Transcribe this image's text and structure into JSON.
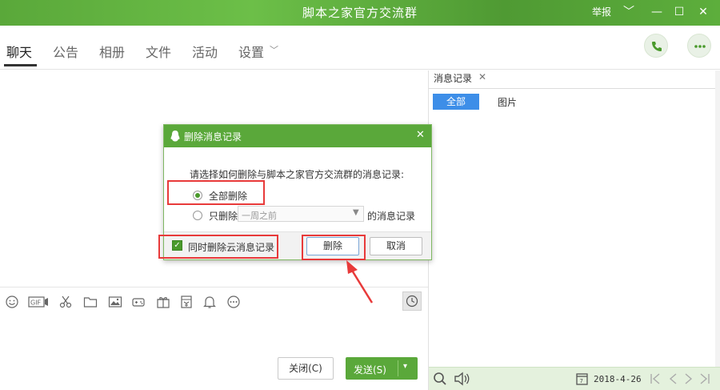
{
  "window": {
    "title": "脚本之家官方交流群",
    "report_label": "举报",
    "controls": [
      "﹀",
      "—",
      "☐",
      "✕"
    ]
  },
  "tabs": [
    {
      "label": "聊天",
      "active": true
    },
    {
      "label": "公告"
    },
    {
      "label": "相册"
    },
    {
      "label": "文件"
    },
    {
      "label": "活动"
    },
    {
      "label": "设置"
    }
  ],
  "tab_settings_chevron": "﹀",
  "composer": {
    "close_label": "关闭(C)",
    "send_label": "发送(S)",
    "send_chevron": "▾"
  },
  "history_panel": {
    "tab_label": "消息记录",
    "tab_close": "✕",
    "filter_all": "全部",
    "filter_images": "图片",
    "date": "2018-4-26"
  },
  "dialog": {
    "title": "删除消息记录",
    "close": "✕",
    "question": "请选择如何删除与脚本之家官方交流群的消息记录:",
    "option_all": "全部删除",
    "option_partial_prefix": "只删除",
    "option_partial_select": "一周之前",
    "option_partial_suffix": "的消息记录",
    "select_chevron": "▼",
    "cloud_checkbox_label": "同时删除云消息记录",
    "checkmark": "✓",
    "delete_button": "删除",
    "cancel_button": "取消"
  },
  "colors": {
    "accent_green": "#5aa83a",
    "selected_blue": "#3d8ee8",
    "annotation_red": "#e83a3a"
  }
}
